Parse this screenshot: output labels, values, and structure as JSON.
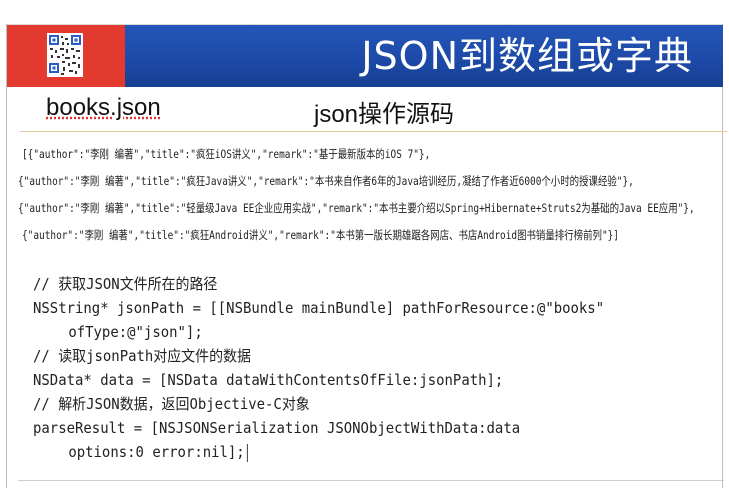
{
  "header": {
    "title": "JSON到数组或字典"
  },
  "subtitles": {
    "left": "books.json",
    "right": "json操作源码"
  },
  "json_lines": [
    "[{\"author\":\"李刚 编著\",\"title\":\"疯狂iOS讲义\",\"remark\":\"基于最新版本的iOS 7\"},",
    "{\"author\":\"李刚 编著\",\"title\":\"疯狂Java讲义\",\"remark\":\"本书来自作者6年的Java培训经历,凝结了作者近6000个小时的授课经验\"},",
    "{\"author\":\"李刚 编著\",\"title\":\"轻量级Java EE企业应用实战\",\"remark\":\"本书主要介绍以Spring+Hibernate+Struts2为基础的Java EE应用\"},",
    "{\"author\":\"李刚 编著\",\"title\":\"疯狂Android讲义\",\"remark\":\"本书第一版长期雄踞各网店、书店Android图书销量排行榜前列\"}]"
  ],
  "code_lines": [
    "// 获取JSON文件所在的路径",
    "NSString* jsonPath = [[NSBundle mainBundle] pathForResource:@\"books\"",
    "ofType:@\"json\"];",
    "// 读取jsonPath对应文件的数据",
    "NSData* data = [NSData dataWithContentsOfFile:jsonPath];",
    "// 解析JSON数据，返回Objective-C对象",
    "parseResult = [NSJSONSerialization JSONObjectWithData:data",
    "options:0 error:nil];"
  ],
  "colors": {
    "header_red": "#e23a2e",
    "header_blue": "#1d4aa8",
    "title_text": "#ffffff"
  },
  "icons": {
    "qr": "qr-code-icon"
  }
}
